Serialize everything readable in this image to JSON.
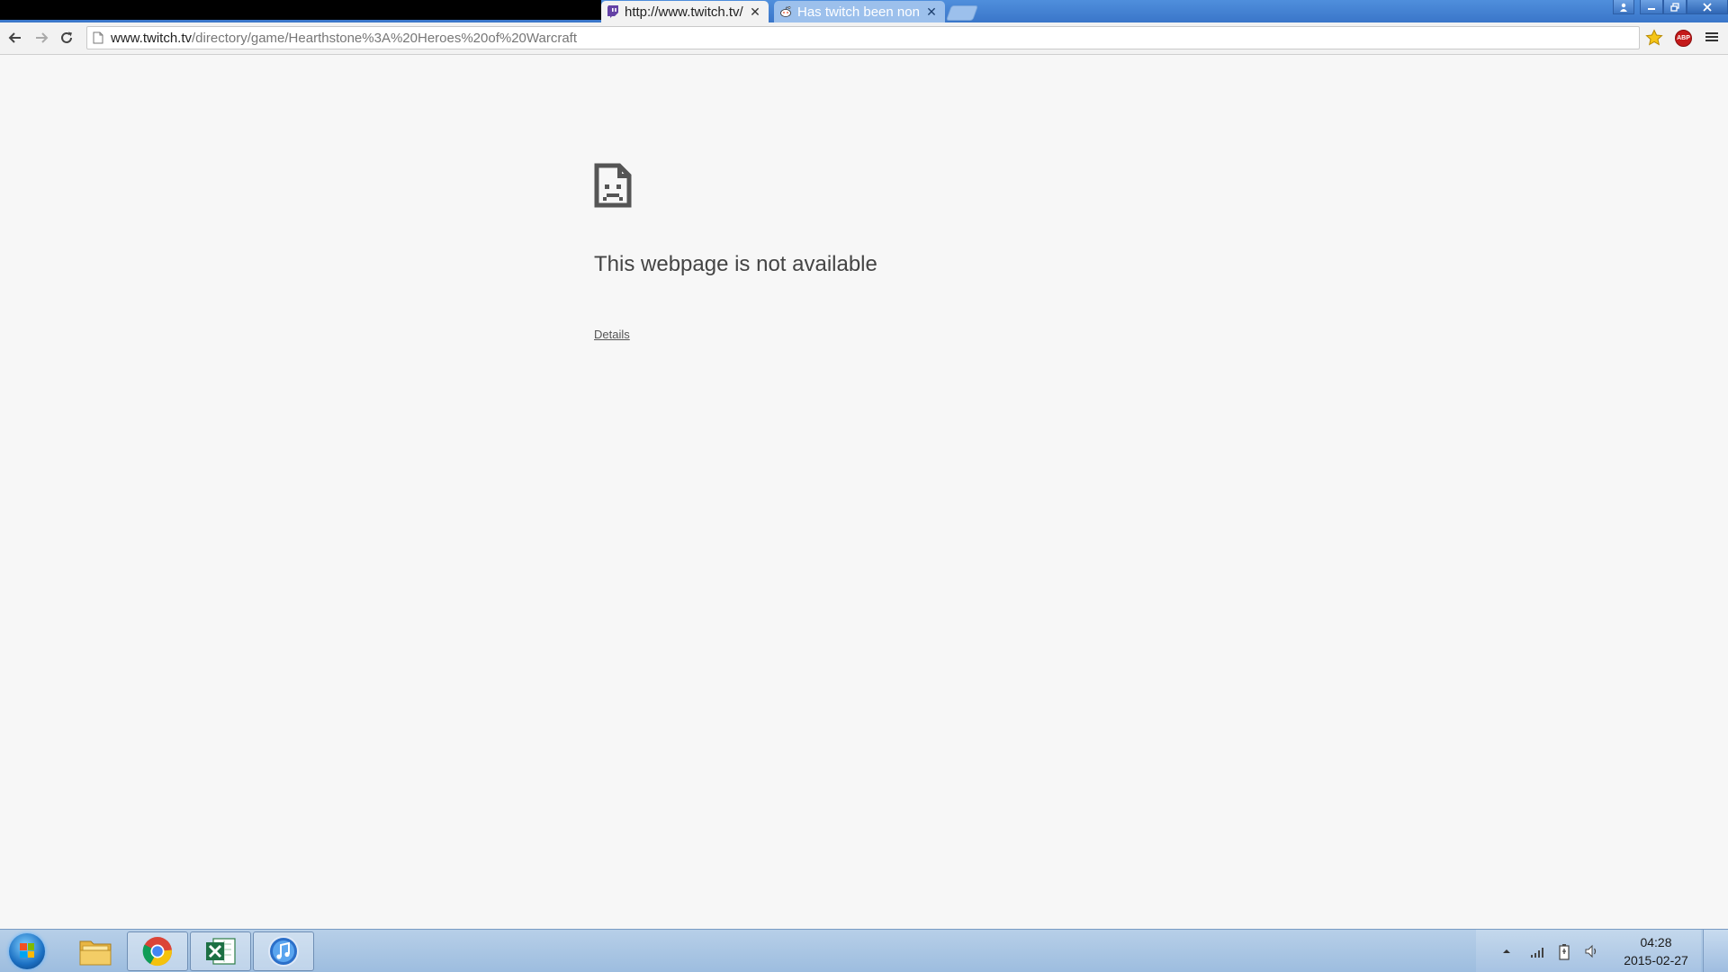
{
  "tabs": [
    {
      "title": "http://www.twitch.tv/",
      "active": true,
      "favicon": "twitch-icon"
    },
    {
      "title": "Has twitch been non",
      "active": false,
      "favicon": "reddit-icon"
    }
  ],
  "address_bar": {
    "url_host": "www.twitch.tv",
    "url_path": "/directory/game/Hearthstone%3A%20Heroes%20of%20Warcraft"
  },
  "extensions": {
    "adblock_label": "ABP"
  },
  "error_page": {
    "title": "This webpage is not available",
    "details_link": "Details"
  },
  "taskbar": {
    "apps": [
      "file-explorer-icon",
      "chrome-icon",
      "excel-icon",
      "itunes-icon"
    ],
    "clock": {
      "time": "04:28",
      "date": "2015-02-27"
    }
  },
  "colors": {
    "titlebar": "#3a76c9",
    "page_background": "#f7f7f7",
    "taskbar": "#a9c6e6",
    "abp_red": "#c41a1a"
  }
}
